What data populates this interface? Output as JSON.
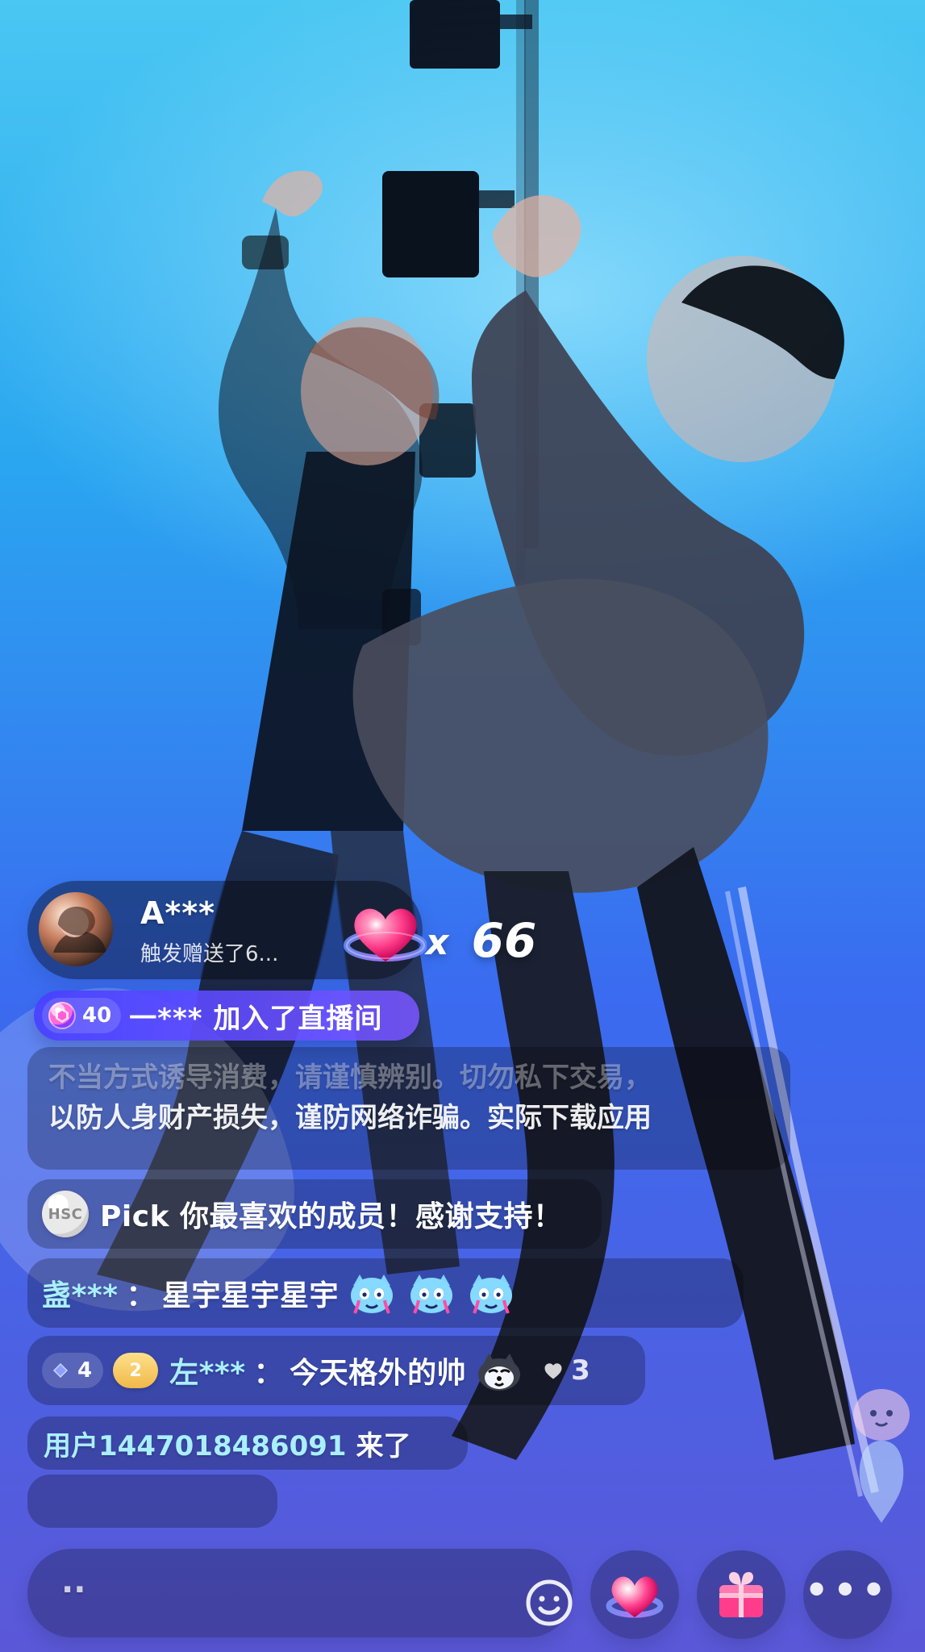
{
  "gift_banner": {
    "username": "A***",
    "subtitle": "触发赠送了6...",
    "multiplier_prefix": "x",
    "multiplier_value": "66",
    "avatar_icon": "avatar-icon",
    "gift_icon": "heart-gift-icon"
  },
  "join_event": {
    "level": "40",
    "text": "一*** 加入了直播间",
    "level_icon": "level-badge-icon"
  },
  "notice": {
    "line1": "不当方式诱导消费，请谨慎辨别。切勿私下交易，",
    "line2": "以防人身财产损失，谨防网络诈骗。实际下载应用"
  },
  "chat": [
    {
      "badge_text": "HSC",
      "message": "Pick 你最喜欢的成员！感谢支持！"
    },
    {
      "user": "盏***",
      "colon": "：",
      "message": "星宇星宇星宇",
      "emoji_icon": "crying-cat-emoji-icon"
    },
    {
      "diamond_value": "4",
      "gold_value": "2",
      "user": "左***",
      "colon": "：",
      "message": "今天格外的帅",
      "emoji_icon": "husky-emoji-icon",
      "likes": "3"
    }
  ],
  "system": {
    "user": "用户1447018486091",
    "action": "来了"
  },
  "bottom": {
    "input_text": "..",
    "emoji_button_icon": "emoji-icon",
    "heart_button_icon": "heart-icon",
    "gift_button_icon": "gift-icon",
    "more_button_label": "•••"
  },
  "colors": {
    "accent_blue": "#3a6bf0",
    "chat_bg": "rgba(0,0,0,0.25)",
    "join_gradient_start": "#4840ff",
    "join_gradient_end": "#7856ff",
    "username_cyan": "#a9f0ff"
  }
}
